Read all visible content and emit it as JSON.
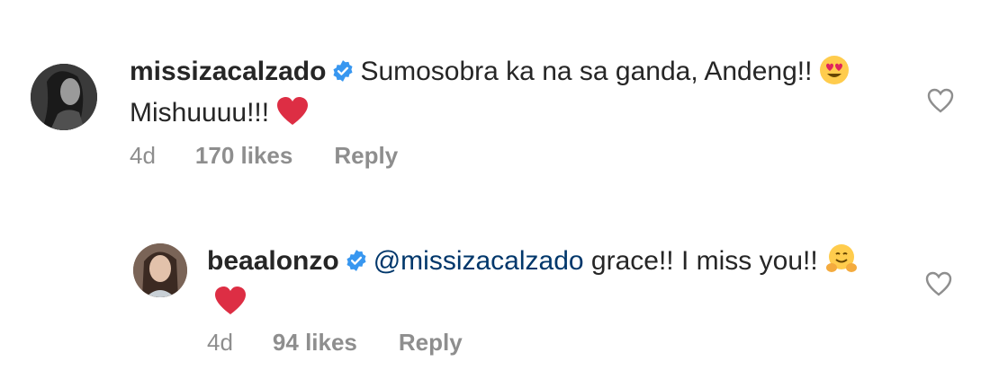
{
  "comments": [
    {
      "username": "missizacalzado",
      "text_part1": "Sumosobra ka na sa ganda, Andeng!!",
      "emoji1": "heart-eyes-emoji",
      "text_part2": "Mishuuuu!!!",
      "emoji2": "red-heart-emoji",
      "time": "4d",
      "likes": "170 likes",
      "reply": "Reply"
    },
    {
      "username": "beaalonzo",
      "mention": "@missizacalzado",
      "text_part1": "grace!! I miss you!!",
      "emoji1": "hugging-face-emoji",
      "emoji2": "red-heart-emoji",
      "time": "4d",
      "likes": "94 likes",
      "reply": "Reply"
    }
  ],
  "colors": {
    "text": "#262626",
    "muted": "#8e8e8e",
    "verified": "#3897f0",
    "mention": "#00376b",
    "heart": "#ed4956"
  },
  "icons": {
    "verified": "verified-badge-icon",
    "like": "heart-outline-icon"
  }
}
